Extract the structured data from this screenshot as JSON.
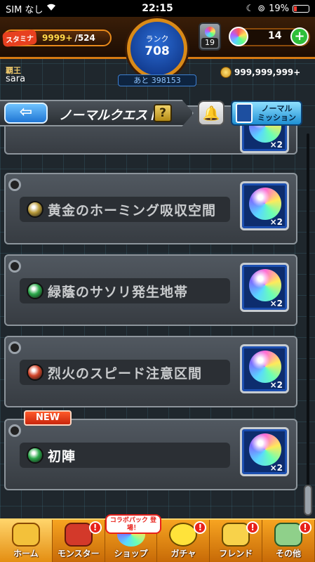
{
  "status_bar": {
    "carrier": "SIM なし",
    "time": "22:15",
    "battery": "19%",
    "battery_level": 0.19
  },
  "hud": {
    "stamina_tag": "スタミナ",
    "stamina_current": "9999+",
    "stamina_max": "/524",
    "rank_label": "ランク",
    "rank_value": "708",
    "exp_remaining": "あと 398153",
    "orb_badge_count": "19",
    "orbs": "14",
    "player_title": "覇王",
    "player_name": "sara",
    "gold": "999,999,999+"
  },
  "quest_header": {
    "title": "ノーマルクエスト",
    "help_label": "?",
    "mission_label_line1": "ノーマル",
    "mission_label_line2": "ミッション"
  },
  "quests": [
    {
      "name": "黄金のホーミング吸収空間",
      "reward": "×2",
      "element_color": "#b89a3a"
    },
    {
      "name": "緑蔭のサソリ発生地帯",
      "reward": "×2",
      "element_color": "#2aa84a"
    },
    {
      "name": "烈火のスピード注意区間",
      "reward": "×2",
      "element_color": "#d2452a"
    },
    {
      "name": "初陣",
      "reward": "×2",
      "element_color": "#2aa84a",
      "badge": "NEW"
    }
  ],
  "partial_top_quest": {
    "reward": "×2"
  },
  "bottom_nav": {
    "items": [
      {
        "label": "ホーム",
        "alert": ""
      },
      {
        "label": "モンスター",
        "alert": "!"
      },
      {
        "label": "ショップ",
        "alert": ""
      },
      {
        "label": "ガチャ",
        "alert": "!"
      },
      {
        "label": "フレンド",
        "alert": "!"
      },
      {
        "label": "その他",
        "alert": "!"
      }
    ],
    "collab_tag": "コラボパック 登場！"
  }
}
